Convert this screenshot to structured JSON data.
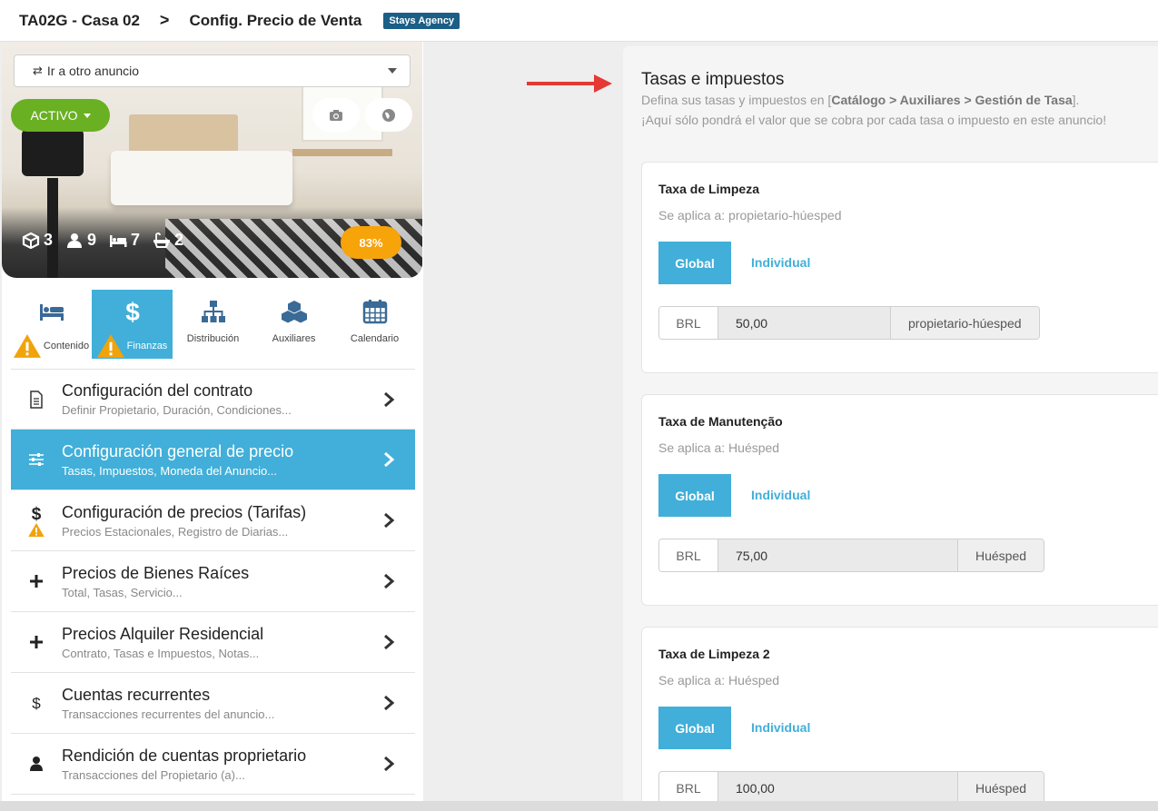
{
  "header": {
    "listing_code": "TA02G - Casa 02",
    "separator": ">",
    "page_title": "Config. Precio de Venta",
    "agency_badge": "Stays Agency"
  },
  "sidebar": {
    "jump_select": {
      "label": "Ir a otro anuncio",
      "arrows": "⇄"
    },
    "status_button": "ACTIVO",
    "stats": [
      {
        "icon": "cube-icon",
        "value": "3"
      },
      {
        "icon": "user-icon",
        "value": "9"
      },
      {
        "icon": "bed-icon",
        "value": "7"
      },
      {
        "icon": "bathtub-icon",
        "value": "2"
      }
    ],
    "completion": "83%",
    "tabs": [
      {
        "label": "Contenido",
        "icon": "bed-icon",
        "warning": true,
        "active": false
      },
      {
        "label": "Finanzas",
        "icon": "dollar-icon",
        "warning": true,
        "active": true
      },
      {
        "label": "Distribución",
        "icon": "sitemap-icon",
        "warning": false,
        "active": false
      },
      {
        "label": "Auxiliares",
        "icon": "cubes-icon",
        "warning": false,
        "active": false
      },
      {
        "label": "Calendario",
        "icon": "calendar-icon",
        "warning": false,
        "active": false
      }
    ],
    "menu": [
      {
        "title": "Configuración del contrato",
        "subtitle": "Definir Propietario, Duración, Condiciones...",
        "icon": "document-icon",
        "active": false
      },
      {
        "title": "Configuración general de precio",
        "subtitle": "Tasas, Impuestos, Moneda del Anuncio...",
        "icon": "sliders-icon",
        "active": true
      },
      {
        "title": "Configuración de precios (Tarifas)",
        "subtitle": "Precios Estacionales, Registro de Diarias...",
        "icon": "dollar-icon",
        "active": false,
        "warning": true
      },
      {
        "title": "Precios de Bienes Raíces",
        "subtitle": "Total, Tasas, Servicio...",
        "icon": "plus-icon",
        "active": false
      },
      {
        "title": "Precios Alquiler Residencial",
        "subtitle": "Contrato, Tasas e Impuestos, Notas...",
        "icon": "plus-icon",
        "active": false
      },
      {
        "title": "Cuentas recurrentes",
        "subtitle": "Transacciones recurrentes del anuncio...",
        "icon": "dollar-icon",
        "active": false
      },
      {
        "title": "Rendición de cuentas proprietario",
        "subtitle": "Transacciones del Propietario (a)...",
        "icon": "user-icon",
        "active": false
      }
    ]
  },
  "content": {
    "title": "Tasas e impuestos",
    "help_prefix": "Defina sus tasas y impuestos en [",
    "help_path": "Catálogo > Auxiliares > Gestión de Tasa",
    "help_suffix": "].",
    "help_line2": "¡Aquí sólo pondrá el valor que se cobra por cada tasa o impuesto en este anuncio!",
    "cards": [
      {
        "name": "Taxa de Limpeza",
        "applies": "Se aplica a: propietario-húesped",
        "global_label": "Global",
        "individual_label": "Individual",
        "currency": "BRL",
        "value": "50,00",
        "suffix": "propietario-húesped"
      },
      {
        "name": "Taxa de Manutenção",
        "applies": "Se aplica a: Huésped",
        "global_label": "Global",
        "individual_label": "Individual",
        "currency": "BRL",
        "value": "75,00",
        "suffix": "Huésped"
      },
      {
        "name": "Taxa de Limpeza 2",
        "applies": "Se aplica a: Huésped",
        "global_label": "Global",
        "individual_label": "Individual",
        "currency": "BRL",
        "value": "100,00",
        "suffix": "Huésped"
      }
    ]
  },
  "colors": {
    "accent": "#41afd9",
    "active_status": "#6ab023",
    "completion": "#f7a30a",
    "badge": "#1b5e86",
    "annotation_arrow": "#e53935"
  }
}
